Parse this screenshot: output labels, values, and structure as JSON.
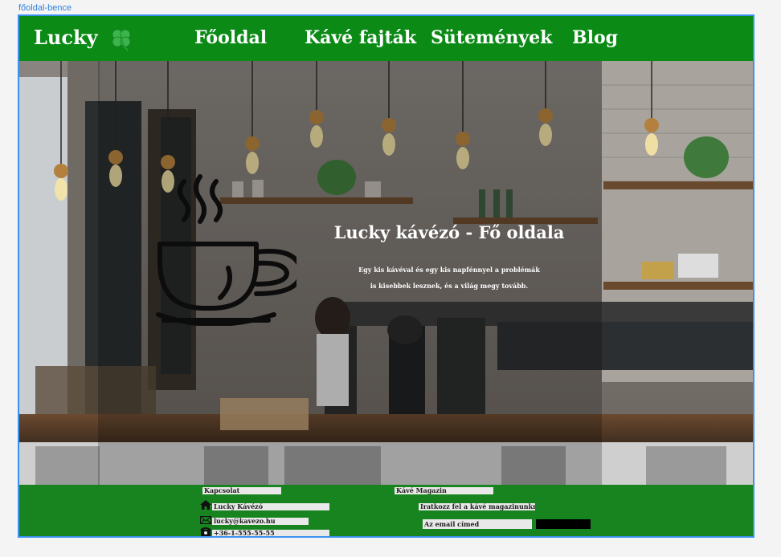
{
  "frame_label": "főoldal-bence",
  "header": {
    "brand": "Lucky",
    "brand_icon": "clover-icon",
    "nav": [
      "Főoldal",
      "Kávé fajták",
      "Sütemények",
      "Blog"
    ]
  },
  "hero": {
    "title": "Lucky kávézó  - Fő oldala",
    "subtitle_line1": "Egy kis kávéval és egy kis napfénnyel a problémák",
    "subtitle_line2": "is kisebbek lesznek, és a világ megy tovább.",
    "icon": "coffee-cup-icon"
  },
  "footer": {
    "contact_heading": "Kapcsolat",
    "contact_name": "Lucky Kávézó",
    "contact_email": "lucky@kavezo.hu",
    "contact_phone": "+36-1-555-55-55",
    "magazine_heading": "Kávé Magazin",
    "magazine_subscribe": "Iratkozz fel a kávé magazinunkra",
    "email_placeholder": "Az email címed",
    "submit_label": ""
  },
  "colors": {
    "header_green": "#0b8a16",
    "footer_green": "#17841f",
    "frame_blue": "#3a92f0"
  }
}
